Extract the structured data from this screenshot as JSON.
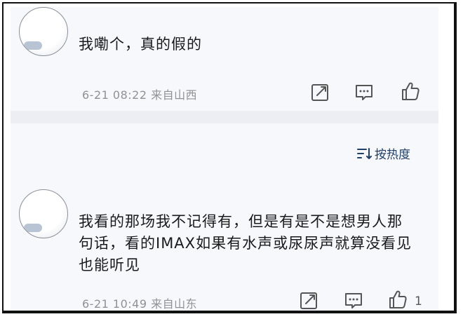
{
  "comments": [
    {
      "text": "我嘞个，真的假的",
      "meta": "6-21 08:22 来自山西",
      "like_count": ""
    },
    {
      "text": "我看的那场我不记得有，但是有是不是想男人那句话，看的IMAX如果有水声或尿尿声就算没看见也能听见",
      "meta": "6-21 10:49 来自山东",
      "like_count": "1"
    }
  ],
  "sort": {
    "label": "按热度"
  },
  "icons": {
    "repost": "share-icon",
    "comment": "comment-icon",
    "like": "thumbs-up-icon",
    "sort": "sort-icon"
  },
  "colors": {
    "panel_bg": "#f7f8fc",
    "meta_text": "#8f9196",
    "sort_text": "#1f3f66",
    "icon_stroke": "#555555"
  }
}
